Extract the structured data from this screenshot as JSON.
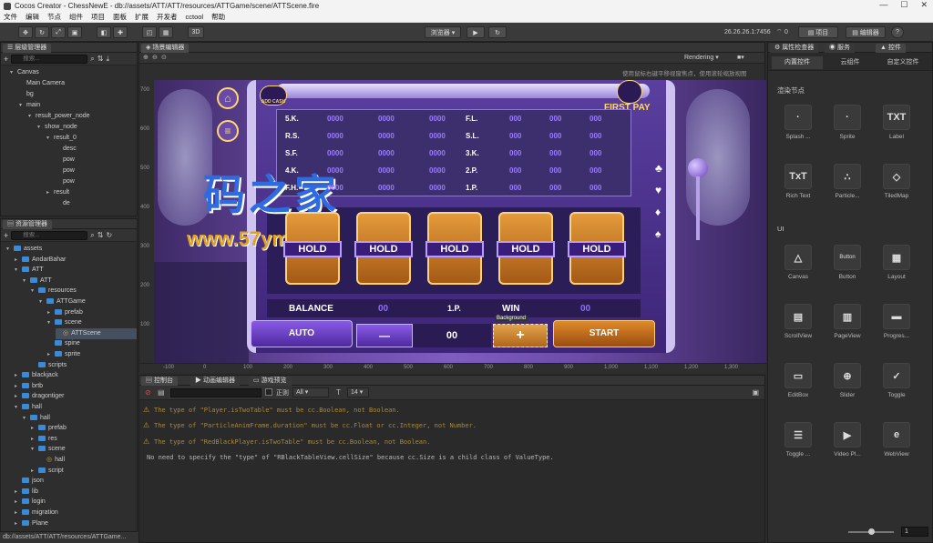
{
  "window": {
    "title": "Cocos Creator - ChessNewE - db://assets/ATT/ATT/resources/ATTGame/scene/ATTScene.fire",
    "controls": [
      "—",
      "☐",
      "✕"
    ]
  },
  "menu": [
    "文件",
    "编辑",
    "节点",
    "组件",
    "项目",
    "面板",
    "扩展",
    "开发者",
    "cctool",
    "帮助"
  ],
  "toolbar": {
    "browser": "浏览器",
    "ip": "26.26.26.1:7456",
    "wifi_count": "0",
    "project": "项目",
    "editor": "编辑器",
    "mode_3d": "3D",
    "help": "?"
  },
  "hierarchy": {
    "tab": "层级管理器",
    "search_placeholder": "搜索...",
    "items": [
      {
        "label": "Canvas",
        "depth": 0,
        "arrow": "▾"
      },
      {
        "label": "Main Camera",
        "depth": 1,
        "arrow": ""
      },
      {
        "label": "bg",
        "depth": 1,
        "arrow": ""
      },
      {
        "label": "main",
        "depth": 1,
        "arrow": "▾"
      },
      {
        "label": "result_power_node",
        "depth": 2,
        "arrow": "▾"
      },
      {
        "label": "show_node",
        "depth": 3,
        "arrow": "▾"
      },
      {
        "label": "result_0",
        "depth": 4,
        "arrow": "▾"
      },
      {
        "label": "desc",
        "depth": 5,
        "arrow": ""
      },
      {
        "label": "pow",
        "depth": 5,
        "arrow": ""
      },
      {
        "label": "pow",
        "depth": 5,
        "arrow": ""
      },
      {
        "label": "pow",
        "depth": 5,
        "arrow": ""
      },
      {
        "label": "result",
        "depth": 4,
        "arrow": "▸"
      },
      {
        "label": "de",
        "depth": 5,
        "arrow": ""
      }
    ]
  },
  "assets": {
    "tab": "资源管理器",
    "search_placeholder": "搜索...",
    "items": [
      {
        "label": "assets",
        "depth": 0,
        "arrow": "▾",
        "folder": true
      },
      {
        "label": "AndarBahar",
        "depth": 1,
        "arrow": "▸",
        "folder": true
      },
      {
        "label": "ATT",
        "depth": 1,
        "arrow": "▾",
        "folder": true
      },
      {
        "label": "ATT",
        "depth": 2,
        "arrow": "▾",
        "folder": true
      },
      {
        "label": "resources",
        "depth": 3,
        "arrow": "▾",
        "folder": true
      },
      {
        "label": "ATTGame",
        "depth": 4,
        "arrow": "▾",
        "folder": true
      },
      {
        "label": "prefab",
        "depth": 5,
        "arrow": "▸",
        "folder": true
      },
      {
        "label": "scene",
        "depth": 5,
        "arrow": "▾",
        "folder": true
      },
      {
        "label": "ATTScene",
        "depth": 6,
        "arrow": "",
        "folder": false,
        "selected": true
      },
      {
        "label": "spine",
        "depth": 5,
        "arrow": "",
        "folder": true
      },
      {
        "label": "sprite",
        "depth": 5,
        "arrow": "▸",
        "folder": true
      },
      {
        "label": "scripts",
        "depth": 3,
        "arrow": "",
        "folder": true
      },
      {
        "label": "blackjack",
        "depth": 1,
        "arrow": "▸",
        "folder": true
      },
      {
        "label": "brtb",
        "depth": 1,
        "arrow": "▸",
        "folder": true
      },
      {
        "label": "dragontiger",
        "depth": 1,
        "arrow": "▸",
        "folder": true
      },
      {
        "label": "hall",
        "depth": 1,
        "arrow": "▾",
        "folder": true
      },
      {
        "label": "hall",
        "depth": 2,
        "arrow": "▾",
        "folder": true
      },
      {
        "label": "prefab",
        "depth": 3,
        "arrow": "▸",
        "folder": true
      },
      {
        "label": "res",
        "depth": 3,
        "arrow": "▸",
        "folder": true
      },
      {
        "label": "scene",
        "depth": 3,
        "arrow": "▾",
        "folder": true
      },
      {
        "label": "hall",
        "depth": 4,
        "arrow": "",
        "folder": false
      },
      {
        "label": "script",
        "depth": 3,
        "arrow": "▸",
        "folder": true
      },
      {
        "label": "json",
        "depth": 1,
        "arrow": "",
        "folder": true
      },
      {
        "label": "lib",
        "depth": 1,
        "arrow": "▸",
        "folder": true
      },
      {
        "label": "login",
        "depth": 1,
        "arrow": "▸",
        "folder": true
      },
      {
        "label": "migration",
        "depth": 1,
        "arrow": "▸",
        "folder": true
      },
      {
        "label": "Plane",
        "depth": 1,
        "arrow": "▸",
        "folder": true
      }
    ],
    "status": "db://assets/ATT/ATT/resources/ATTGame..."
  },
  "scene": {
    "tab": "场景编辑器",
    "rendering": "Rendering",
    "hint": "使用鼠标右键平移视窗焦点，使用滚轮缩放视图",
    "y_ticks": [
      "700",
      "600",
      "500",
      "400",
      "300",
      "200",
      "100"
    ],
    "x_ticks": [
      "-100",
      "0",
      "100",
      "200",
      "300",
      "400",
      "500",
      "600",
      "700",
      "800",
      "900",
      "1,000",
      "1,100",
      "1,200",
      "1,300"
    ]
  },
  "game": {
    "first_pay": "FIRST PAY",
    "add_cash": "ADD CASH",
    "paytable_left": [
      {
        "name": "5.K.",
        "vals": [
          "0000",
          "0000",
          "0000"
        ]
      },
      {
        "name": "R.S.",
        "vals": [
          "0000",
          "0000",
          "0000"
        ]
      },
      {
        "name": "S.F.",
        "vals": [
          "0000",
          "0000",
          "0000"
        ]
      },
      {
        "name": "4.K.",
        "vals": [
          "0000",
          "0000",
          "0000"
        ]
      },
      {
        "name": "F.H.",
        "vals": [
          "0000",
          "0000",
          "0000"
        ]
      }
    ],
    "paytable_right": [
      {
        "name": "F.L.",
        "vals": [
          "000",
          "000",
          "000"
        ]
      },
      {
        "name": "S.L.",
        "vals": [
          "000",
          "000",
          "000"
        ]
      },
      {
        "name": "3.K.",
        "vals": [
          "000",
          "000",
          "000"
        ]
      },
      {
        "name": "2.P.",
        "vals": [
          "000",
          "000",
          "000"
        ]
      },
      {
        "name": "1.P.",
        "vals": [
          "000",
          "000",
          "000"
        ]
      }
    ],
    "hold_labels": [
      "HOLD",
      "HOLD",
      "HOLD",
      "HOLD",
      "HOLD"
    ],
    "balance_label": "BALANCE",
    "balance_value": "00",
    "rank_label": "1.P.",
    "win_label": "WIN",
    "win_value": "00",
    "auto": "AUTO",
    "minus": "—",
    "bet": "00",
    "plus": "+",
    "background_tag": "Background",
    "start": "START",
    "suits": [
      "♣",
      "♥",
      "♦",
      "♠"
    ]
  },
  "watermark": {
    "brand": "码之家",
    "url": "www.57ym.com"
  },
  "console": {
    "tabs": [
      "控制台",
      "动画编辑器",
      "游戏预览"
    ],
    "regex": "正则",
    "filter": "All",
    "font_size": "14",
    "lines": [
      {
        "type": "warn",
        "text": "The type of \"Player.isTwoTable\" must be cc.Boolean, not Boolean."
      },
      {
        "type": "warn",
        "text": "The type of \"ParticleAnimFrame.duration\" must be cc.Float or cc.Integer, not Number."
      },
      {
        "type": "warn",
        "text": "The type of \"RedBlackPlayer.isTwoTable\" must be cc.Boolean, not Boolean."
      },
      {
        "type": "info",
        "text": "No need to specify the \"type\" of \"RBlackTableView.cellSize\" because cc.Size is a child class of ValueType."
      }
    ]
  },
  "inspector": {
    "tabs": [
      "属性检查器",
      "服务",
      "控件"
    ],
    "subtabs": [
      "内置控件",
      "云组件",
      "自定义控件"
    ],
    "section_render": "渲染节点",
    "section_ui": "UI",
    "render_items": [
      {
        "label": "Splash ...",
        "glyph": "·"
      },
      {
        "label": "Sprite",
        "glyph": "·"
      },
      {
        "label": "Label",
        "glyph": "TXT"
      },
      {
        "label": "Rich Text",
        "glyph": "TxT"
      },
      {
        "label": "Particle...",
        "glyph": "∴"
      },
      {
        "label": "TiledMap",
        "glyph": "◇"
      }
    ],
    "ui_items": [
      {
        "label": "Canvas",
        "glyph": "△"
      },
      {
        "label": "Button",
        "glyph": "Button"
      },
      {
        "label": "Layout",
        "glyph": "▦"
      },
      {
        "label": "ScrollView",
        "glyph": "▤"
      },
      {
        "label": "PageView",
        "glyph": "▥"
      },
      {
        "label": "Progres...",
        "glyph": "▬"
      },
      {
        "label": "EditBox",
        "glyph": "▭"
      },
      {
        "label": "Slider",
        "glyph": "⊕"
      },
      {
        "label": "Toggle",
        "glyph": "✓"
      },
      {
        "label": "Toggle ...",
        "glyph": "☰"
      },
      {
        "label": "Video Pl...",
        "glyph": "▶"
      },
      {
        "label": "WebView",
        "glyph": "e"
      }
    ],
    "zoom_value": "1"
  }
}
